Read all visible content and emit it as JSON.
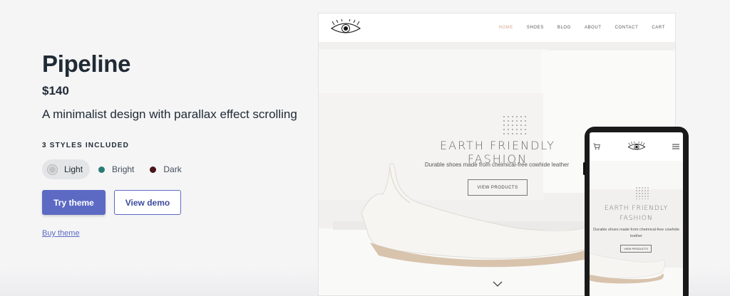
{
  "theme": {
    "name": "Pipeline",
    "price": "$140",
    "tagline": "A minimalist design with parallax effect scrolling",
    "styles_label": "3 STYLES INCLUDED",
    "styles": [
      {
        "label": "Light",
        "color": "#c4c4c4",
        "selected": true
      },
      {
        "label": "Bright",
        "color": "#2b7a78",
        "selected": false
      },
      {
        "label": "Dark",
        "color": "#4a1518",
        "selected": false
      }
    ],
    "try_label": "Try theme",
    "demo_label": "View demo",
    "buy_label": "Buy theme",
    "accent_color": "#5c6ac4"
  },
  "desktop_preview": {
    "nav": [
      "HOME",
      "SHOES",
      "BLOG",
      "ABOUT",
      "CONTACT",
      "CART"
    ],
    "active_nav": "HOME",
    "hero_heading": "EARTH FRIENDLY FASHION",
    "hero_sub": "Durable shoes made from cheimical-free cowhide leather",
    "hero_button": "VIEW PRODUCTS"
  },
  "mobile_preview": {
    "hero_heading_line1": "EARTH FRIENDLY",
    "hero_heading_line2": "FASHION",
    "hero_sub_line1": "Durable shoes made from cheimical-free cowhide",
    "hero_sub_line2": "leather",
    "hero_button": "VIEW PRODUCTS"
  }
}
